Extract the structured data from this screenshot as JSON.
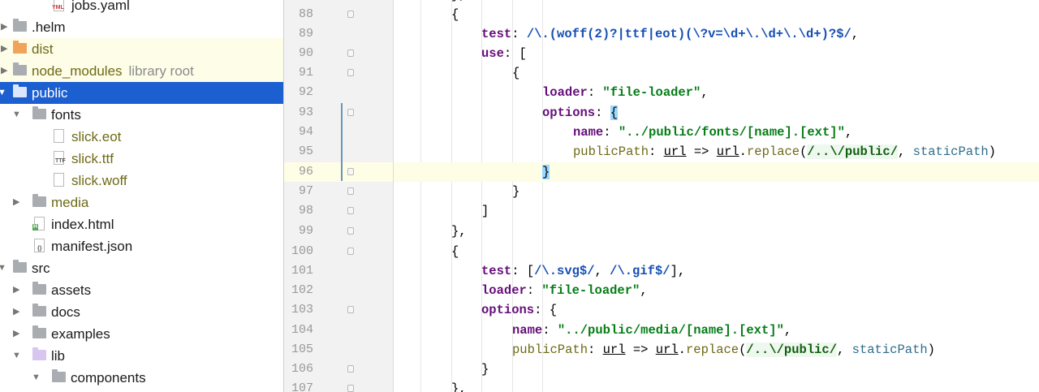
{
  "project_tree": {
    "rows": [
      {
        "label": "jobs.yaml",
        "icon": "yaml-file-icon",
        "badge": "YML"
      },
      {
        "label": ".helm",
        "icon": "folder-icon"
      },
      {
        "label": "dist",
        "icon": "folder-icon"
      },
      {
        "label": "node_modules",
        "extra": "library root",
        "icon": "folder-icon"
      },
      {
        "label": "public",
        "icon": "folder-icon",
        "selected": true
      },
      {
        "label": "fonts",
        "icon": "folder-icon"
      },
      {
        "label": "slick.eot",
        "icon": "file-icon"
      },
      {
        "label": "slick.ttf",
        "icon": "font-file-icon",
        "badge": "TTF"
      },
      {
        "label": "slick.woff",
        "icon": "file-icon"
      },
      {
        "label": "media",
        "icon": "folder-icon"
      },
      {
        "label": "index.html",
        "icon": "html-file-icon",
        "badge": "H"
      },
      {
        "label": "manifest.json",
        "icon": "json-file-icon",
        "badge": "{}"
      },
      {
        "label": "src",
        "icon": "folder-icon"
      },
      {
        "label": "assets",
        "icon": "folder-icon"
      },
      {
        "label": "docs",
        "icon": "folder-icon"
      },
      {
        "label": "examples",
        "icon": "folder-icon"
      },
      {
        "label": "lib",
        "icon": "folder-icon"
      },
      {
        "label": "components",
        "icon": "folder-icon"
      }
    ]
  },
  "editor": {
    "current_line": 96,
    "line_numbers": [
      "88",
      "89",
      "90",
      "91",
      "92",
      "93",
      "94",
      "95",
      "96",
      "97",
      "98",
      "99",
      "100",
      "101",
      "102",
      "103",
      "104",
      "105",
      "106",
      "107"
    ],
    "code": {
      "l87": "},",
      "l88": "{",
      "l89_key": "test",
      "l89_regex": "/\\.(woff(2)?|ttf|eot)(\\?v=\\d+\\.\\d+\\.\\d+)?$/",
      "l90_key": "use",
      "l90_open": "[",
      "l91": "{",
      "l92_key": "loader",
      "l92_val": "\"file-loader\"",
      "l93_key": "options",
      "l93_open": "{",
      "l94_key": "name",
      "l94_val": "\"../public/fonts/[name].[ext]\"",
      "l95_key": "publicPath",
      "l95_param": "url",
      "l95_arrow": "=>",
      "l95_obj": "url",
      "l95_method": "replace",
      "l95_regex": "/..\\/public/",
      "l95_arg": "staticPath",
      "l96": "}",
      "l97": "}",
      "l98": "]",
      "l99": "},",
      "l100": "{",
      "l101_key": "test",
      "l101_regex1": "/\\.svg$/",
      "l101_regex2": "/\\.gif$/",
      "l102_key": "loader",
      "l102_val": "\"file-loader\"",
      "l103_key": "options",
      "l103_open": "{",
      "l104_key": "name",
      "l104_val": "\"../public/media/[name].[ext]\"",
      "l105_key": "publicPath",
      "l105_param": "url",
      "l105_arrow": "=>",
      "l105_obj": "url",
      "l105_method": "replace",
      "l105_regex": "/..\\/public/",
      "l105_arg": "staticPath",
      "l106": "}",
      "l107": "},"
    }
  },
  "colors": {
    "selection": "#1b5fd1",
    "highlight_row": "#fefde8",
    "keyword": "#660e7a",
    "string": "#067d17",
    "regex": "#0f5f0f",
    "method": "#6e6a16",
    "vcs_change": "#6897bb"
  }
}
